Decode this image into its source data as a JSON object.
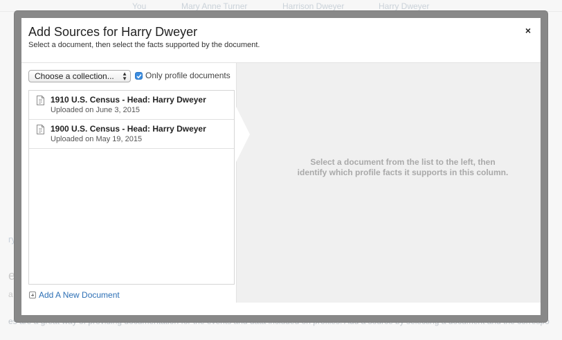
{
  "background": {
    "nav": [
      "You",
      "Mary Anne Turner",
      "Harrison Dweyer",
      "Harry Dweyer"
    ],
    "letters": [
      "ry",
      "e",
      "a"
    ],
    "footer": "es are a great way of providing documentation for the events and data included on profiles. Add a source by selecting a document and the correspo"
  },
  "modal": {
    "title": "Add Sources for Harry Dweyer",
    "subtitle": "Select a document, then select the facts supported by the document.",
    "close_label": "×"
  },
  "left_panel": {
    "collection_select": {
      "selected": "Choose a collection...",
      "options": [
        "Choose a collection..."
      ]
    },
    "only_profile_documents": {
      "label": "Only profile documents",
      "checked": true
    },
    "documents": [
      {
        "title": "1910 U.S. Census - Head: Harry Dweyer",
        "date": "Uploaded on June 3, 2015"
      },
      {
        "title": "1900 U.S. Census - Head: Harry Dweyer",
        "date": "Uploaded on May 19, 2015"
      }
    ],
    "add_document_label": "Add A New Document"
  },
  "right_panel": {
    "message_line1": "Select a document from the list to the left, then",
    "message_line2": "identify which profile facts it supports in this column."
  },
  "colors": {
    "checkbox_blue": "#3b8de0",
    "link_blue": "#2c6fb5",
    "panel_gray": "#f0f0f0",
    "placeholder_text": "#a9a9a9"
  }
}
